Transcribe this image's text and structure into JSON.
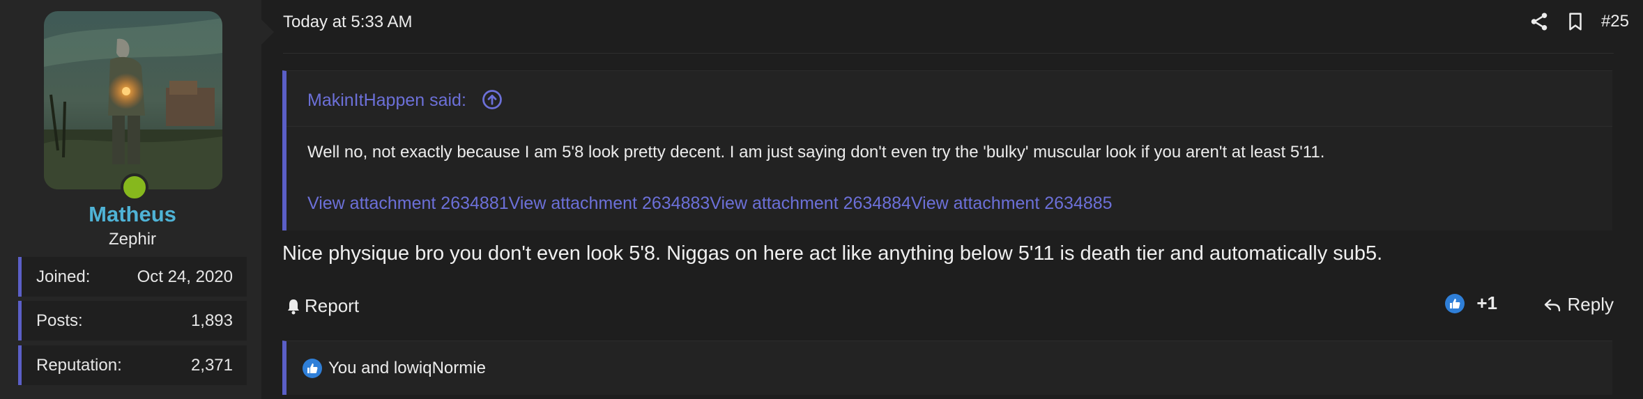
{
  "user": {
    "name": "Matheus",
    "title": "Zephir",
    "avatar_icon": "avatar-image",
    "online_color": "#86b81d",
    "stats": [
      {
        "label": "Joined:",
        "value": "Oct 24, 2020"
      },
      {
        "label": "Posts:",
        "value": "1,893"
      },
      {
        "label": "Reputation:",
        "value": "2,371"
      }
    ]
  },
  "post": {
    "date": "Today at 5:33 AM",
    "number": "#25",
    "body": "Nice physique bro you don't even look 5'8. Niggas on here act like anything below 5'11 is death tier and automatically sub5."
  },
  "quote": {
    "author": "MakinItHappen said:",
    "text": "Well no, not exactly because I am 5'8 look pretty decent. I am just saying don't even try the 'bulky' muscular look if you aren't at least 5'11.",
    "attachments": [
      "View attachment 2634881",
      "View attachment 2634883",
      "View attachment 2634884",
      "View attachment 2634885"
    ]
  },
  "actions": {
    "report_label": "Report",
    "like_count": "+1",
    "reply_label": "Reply"
  },
  "reactions": {
    "text": "You and lowiqNormie"
  },
  "colors": {
    "accent": "#5b5fc7",
    "link": "#6c70d8",
    "username": "#4fb3d6",
    "like_blue": "#2f7fd8"
  }
}
